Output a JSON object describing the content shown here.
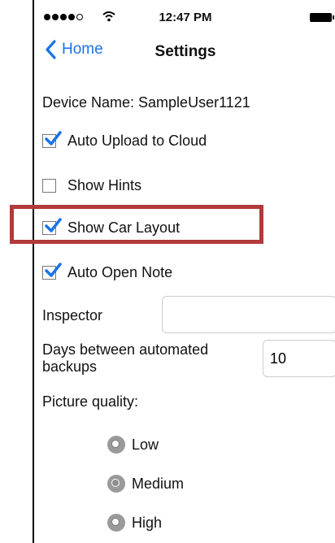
{
  "status_bar": {
    "time": "12:47 PM"
  },
  "nav": {
    "back_label": "Home",
    "title": "Settings"
  },
  "device_name": "Device Name: SampleUser1121",
  "options": [
    {
      "label": "Auto Upload to Cloud",
      "checked": true
    },
    {
      "label": "Show Hints",
      "checked": false
    },
    {
      "label": "Show Car Layout",
      "checked": true
    },
    {
      "label": "Auto Open Note",
      "checked": true
    }
  ],
  "inspector": {
    "label": "Inspector",
    "value": ""
  },
  "backups": {
    "label_line1": "Days between automated",
    "label_line2": "backups",
    "value": "10"
  },
  "picture_quality": {
    "label": "Picture quality:",
    "options": [
      {
        "label": "Low",
        "selected": false
      },
      {
        "label": "Medium",
        "selected": true
      },
      {
        "label": "High",
        "selected": false
      }
    ]
  },
  "colors": {
    "accent": "#1a73e8",
    "highlight": "#b33a3a",
    "check": "#1a73e8"
  },
  "icons": [
    "signal-dots-icon",
    "wifi-icon",
    "battery-icon",
    "chevron-left-icon",
    "checkmark-icon",
    "radio-icon"
  ]
}
